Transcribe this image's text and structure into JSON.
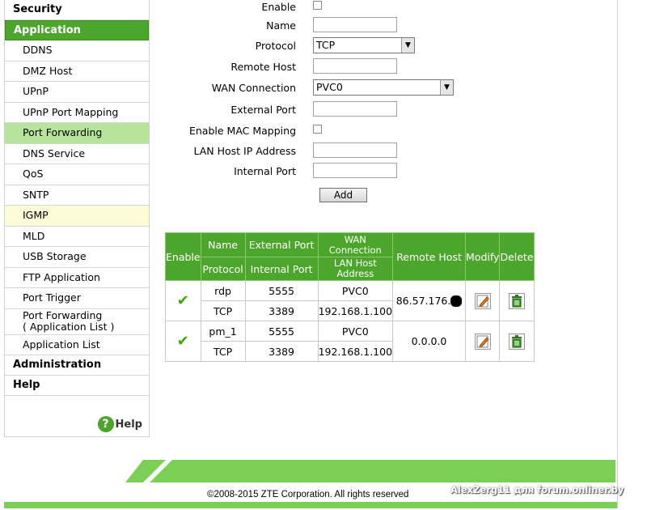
{
  "sidebar": {
    "sections": [
      {
        "label": "Security",
        "active": false,
        "items": []
      },
      {
        "label": "Application",
        "active": true,
        "items": [
          {
            "label": "DDNS",
            "state": "normal"
          },
          {
            "label": "DMZ Host",
            "state": "normal"
          },
          {
            "label": "UPnP",
            "state": "normal"
          },
          {
            "label": "UPnP Port Mapping",
            "state": "normal"
          },
          {
            "label": "Port Forwarding",
            "state": "selected"
          },
          {
            "label": "DNS Service",
            "state": "normal"
          },
          {
            "label": "QoS",
            "state": "normal"
          },
          {
            "label": "SNTP",
            "state": "normal"
          },
          {
            "label": "IGMP",
            "state": "hover"
          },
          {
            "label": "MLD",
            "state": "normal"
          },
          {
            "label": "USB Storage",
            "state": "normal"
          },
          {
            "label": "FTP Application",
            "state": "normal"
          },
          {
            "label": "Port Trigger",
            "state": "normal"
          },
          {
            "label": "Port Forwarding",
            "label2": "( Application List )",
            "state": "normal"
          },
          {
            "label": "Application List",
            "state": "normal"
          }
        ]
      },
      {
        "label": "Administration",
        "active": false,
        "items": []
      },
      {
        "label": "Help",
        "active": false,
        "items": []
      }
    ],
    "help_link": {
      "icon": "?",
      "label": "Help"
    }
  },
  "form": {
    "enable_label": "Enable",
    "name_label": "Name",
    "protocol_label": "Protocol",
    "protocol_value": "TCP",
    "remote_host_label": "Remote Host",
    "wan_connection_label": "WAN Connection",
    "wan_connection_value": "PVC0",
    "external_port_label": "External Port",
    "enable_mac_label": "Enable MAC Mapping",
    "lan_host_ip_label": "LAN Host IP Address",
    "internal_port_label": "Internal Port",
    "add_label": "Add"
  },
  "table": {
    "headers": {
      "enable": "Enable",
      "name": "Name",
      "protocol": "Protocol",
      "external_port": "External Port",
      "internal_port": "Internal Port",
      "wan_connection": "WAN Connection",
      "lan_host_address": "LAN Host Address",
      "remote_host": "Remote Host",
      "modify": "Modify",
      "delete": "Delete"
    },
    "rows": [
      {
        "enabled": true,
        "name": "rdp",
        "protocol": "TCP",
        "external_port": "5555",
        "internal_port": "3389",
        "wan_connection": "PVC0",
        "lan_host": "192.168.1.100",
        "remote_host": "86.57.176."
      },
      {
        "enabled": true,
        "name": "pm_1",
        "protocol": "TCP",
        "external_port": "5555",
        "internal_port": "3389",
        "wan_connection": "PVC0",
        "lan_host": "192.168.1.100",
        "remote_host": "0.0.0.0"
      }
    ]
  },
  "footer": {
    "copyright": "©2008-2015 ZTE Corporation. All rights reserved",
    "watermark": "AlexZerg11 для forum.onliner.by"
  },
  "colors": {
    "accent_green": "#4da62c",
    "selected_item": "#b5e49a",
    "hover_item": "#fdfcd8",
    "footer_green": "#7ccf55"
  }
}
